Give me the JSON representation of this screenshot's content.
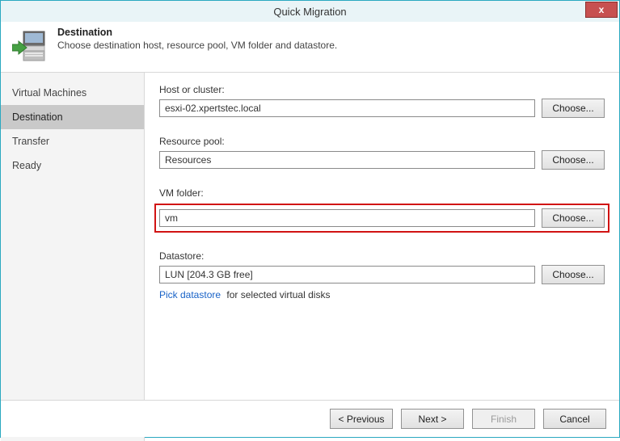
{
  "window": {
    "title": "Quick Migration",
    "close_glyph": "x"
  },
  "header": {
    "title": "Destination",
    "subtitle": "Choose destination host, resource pool, VM folder and datastore."
  },
  "sidebar": {
    "items": [
      {
        "label": "Virtual Machines",
        "active": false
      },
      {
        "label": "Destination",
        "active": true
      },
      {
        "label": "Transfer",
        "active": false
      },
      {
        "label": "Ready",
        "active": false
      }
    ]
  },
  "fields": {
    "host": {
      "label": "Host or cluster:",
      "value": "esxi-02.xpertstec.local",
      "choose": "Choose..."
    },
    "pool": {
      "label": "Resource pool:",
      "value": "Resources",
      "choose": "Choose..."
    },
    "folder": {
      "label": "VM folder:",
      "value": "vm",
      "choose": "Choose..."
    },
    "datastore": {
      "label": "Datastore:",
      "value": "LUN [204.3 GB free]",
      "choose": "Choose...",
      "hint_link": "Pick datastore",
      "hint_rest": "for selected virtual disks"
    }
  },
  "footer": {
    "previous": "< Previous",
    "next": "Next >",
    "finish": "Finish",
    "cancel": "Cancel"
  }
}
